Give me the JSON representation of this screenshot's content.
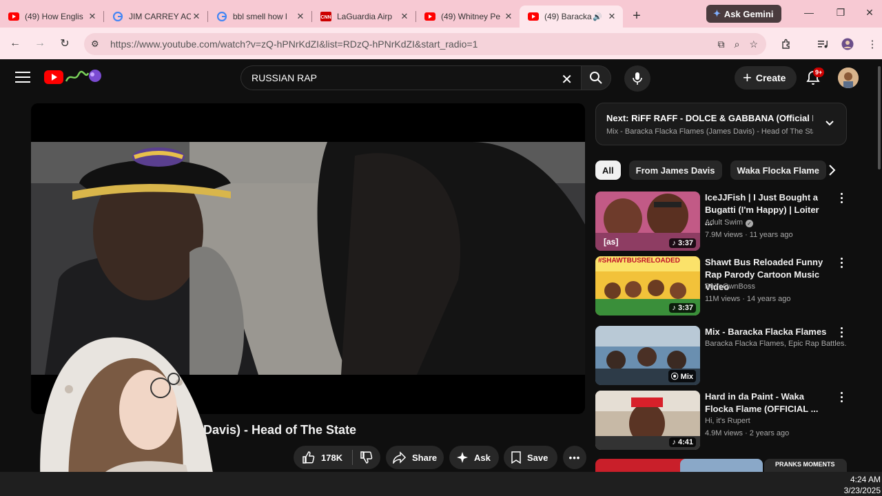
{
  "browser": {
    "tabs": [
      {
        "title": "(49) How Englis",
        "favicon": "youtube"
      },
      {
        "title": "JIM CARREY AC",
        "favicon": "google"
      },
      {
        "title": "bbl smell how l",
        "favicon": "google"
      },
      {
        "title": "LaGuardia Airp",
        "favicon": "cnn"
      },
      {
        "title": "(49) Whitney Pe",
        "favicon": "youtube"
      },
      {
        "title": "(49) Baracka",
        "favicon": "youtube",
        "active": true,
        "audio": true
      }
    ],
    "gemini_label": "Ask Gemini",
    "url": "https://www.youtube.com/watch?v=zQ-hPNrKdZI&list=RDzQ-hPNrKdZI&start_radio=1",
    "colors": {
      "tabstrip": "#f7c9d3",
      "toolbar": "#fde7ec"
    }
  },
  "youtube": {
    "search_query": "RUSSIAN RAP",
    "create_label": "Create",
    "notification_badge": "9+",
    "video_title": "es Davis) - Head of The State",
    "actions": {
      "likes": "178K",
      "share": "Share",
      "ask": "Ask",
      "save": "Save"
    },
    "up_next": {
      "title": "Next: RiFF RAFF - DOLCE & GABBANA (Official Mus...",
      "subtitle": "Mix - Baracka Flacka Flames (James Davis) - Head of The Stat"
    },
    "chips": [
      "All",
      "From James Davis",
      "Waka Flocka Flame"
    ],
    "recommendations": [
      {
        "title": "IceJJFish | I Just Bought a Bugatti (I'm Happy) | Loiter ...",
        "channel": "Adult Swim",
        "verified": true,
        "meta": "7.9M views · 11 years ago",
        "duration": "3:37",
        "thumb_tag": "[as]"
      },
      {
        "title": "Shawt Bus Reloaded Funny Rap Parody Cartoon Music Video",
        "channel": "BeYoOwnBoss",
        "verified": false,
        "meta": "11M views · 14 years ago",
        "duration": "3:37",
        "thumb_tag": "#SHAWTBUSRELOADED"
      },
      {
        "title": "Mix - Baracka Flacka Flames",
        "channel": "Baracka Flacka Flames, Epic Rap Battles...",
        "verified": false,
        "meta": "",
        "duration": "Mix",
        "thumb_tag": ""
      },
      {
        "title": "Hard in da Paint - Waka Flocka Flame (OFFICIAL ...",
        "channel": "Hi, it's Rupert",
        "verified": false,
        "meta": "4.9M views · 2 years ago",
        "duration": "4:41",
        "thumb_tag": ""
      }
    ],
    "partial_thumb_text": "PRANKS MOMENTS"
  },
  "taskbar": {
    "time": "4:24 AM",
    "date": "3/23/2025"
  }
}
